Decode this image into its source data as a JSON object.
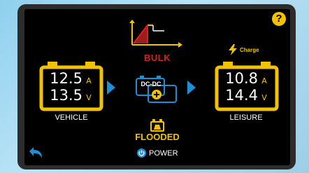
{
  "help": {
    "icon": "question-icon",
    "label": "?"
  },
  "mode": {
    "label": "BULK",
    "color": "#e01e1e"
  },
  "vehicle": {
    "current": "12.5",
    "current_unit": "A",
    "voltage": "13.5",
    "voltage_unit": "V",
    "label": "VEHICLE"
  },
  "leisure": {
    "current": "10.8",
    "current_unit": "A",
    "voltage": "14.4",
    "voltage_unit": "V",
    "label": "LEISURE",
    "status": "Charge"
  },
  "converter": {
    "label": "DC-DC"
  },
  "battery_type": {
    "label": "FLOODED"
  },
  "power": {
    "label": "POWER"
  },
  "colors": {
    "accent": "#f2c200",
    "blue": "#1e8fd6",
    "red": "#e01e1e"
  }
}
